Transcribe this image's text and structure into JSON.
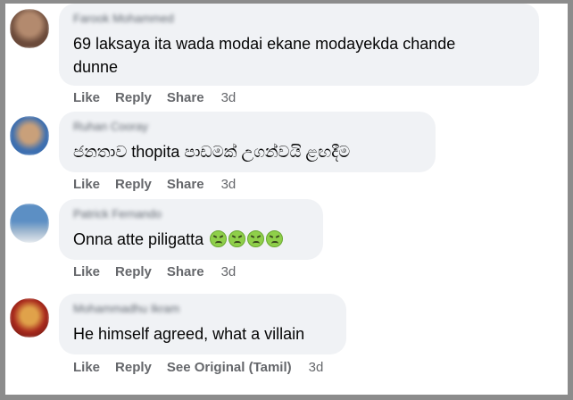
{
  "comments": [
    {
      "author": "Farook Mohammed",
      "text_line1": "69 laksaya ita wada modai ekane modayekda chande",
      "text_line2": "dunne",
      "actions": [
        "Like",
        "Reply",
        "Share"
      ],
      "time": "3d",
      "avatar_colors": [
        "#6b4a3a",
        "#b38a6e"
      ]
    },
    {
      "author": "Ruhan Cooray",
      "text_line1": "ජනතාව thopita පාඩමක් උගන්වයි ළඟදීම",
      "actions": [
        "Like",
        "Reply",
        "Share"
      ],
      "time": "3d",
      "avatar_colors": [
        "#3d6fb0",
        "#c9a07a"
      ]
    },
    {
      "author": "Patrick Fernando",
      "text_line1": "Onna atte piligatta",
      "emoji": [
        "nauseated-face",
        "nauseated-face",
        "nauseated-face",
        "nauseated-face"
      ],
      "actions": [
        "Like",
        "Reply",
        "Share"
      ],
      "time": "3d",
      "avatar_colors": [
        "#5c8fc4",
        "#9fb7cf"
      ]
    },
    {
      "author": "Mohammadhu Ikram",
      "text_line1": "He himself agreed, what a villain",
      "actions": [
        "Like",
        "Reply",
        "See Original (Tamil)"
      ],
      "time": "3d",
      "avatar_colors": [
        "#a8281c",
        "#e0a24a"
      ]
    }
  ]
}
